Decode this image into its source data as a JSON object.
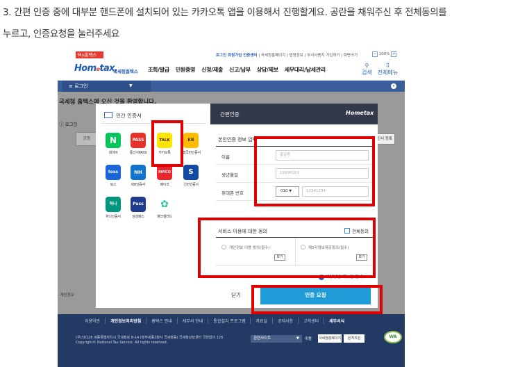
{
  "caption": {
    "line1": "3. 간편 인증 중에 대부분  핸드폰에 설치되어 있는 카카오톡 앱을 이용해서 진행할게요. 공란을 채워주신 후 전체동의를",
    "line2": "누르고, 인증요청을 눌러주세요"
  },
  "hometax": {
    "my_badge": "My홈택스",
    "top_links_bold": "로그인  회원가입  인증센터",
    "top_links": " | 국세청홈페이지 | 법령정보 | 부서사용자 가입하기 | 화면크기",
    "zoom_minus": "−",
    "zoom_value": "100%",
    "zoom_plus": "+",
    "logo_main": "Hom",
    "logo_e": "e",
    "logo_end": "tax,",
    "logo_sub": "국세청홈택스",
    "menu": [
      "조회/발급",
      "민원증명",
      "신청/제출",
      "신고/납부",
      "상담/제보",
      "세무대리/납세관리"
    ],
    "search_icon": "⚲",
    "search_label": "검색",
    "menu_icon": "⠿",
    "menu_label": "전체메뉴",
    "login_tab": "≡ 로그인",
    "login_caret": "▼",
    "expand_icon": "▾",
    "bg_title": "국세청 홈택스에 오신 것을 환영합니다.",
    "bg_line": "ⓘ 로그인",
    "bg_button": "공동",
    "bg_cert": "적용",
    "bg_register": "인서 등록",
    "bg_privacy": "· 개인정보",
    "footer_menu": [
      "이용약관",
      "개인정보처리방침",
      "홈택스 안내",
      "세무서 안내",
      "통합설치 프로그램",
      "자료실",
      "공지사항",
      "고객센터",
      "세무서식"
    ],
    "footer_addr1": "(우)30128 세종특별자치시 국세청로 8-14 (정부세종2청사 국세청동) 국세청상담센터 국번없이 126",
    "footer_addr2": "Copyright© National Tax Service. All rights reserved.",
    "footer_select": "관련사이트",
    "footer_select_caret": "▼",
    "footer_go": "이동",
    "footer_b1": "국세청홈페이지",
    "footer_b2": "원격지원",
    "wa_mark": "WA"
  },
  "cert_panel": {
    "title": "민간 인증서",
    "apps": [
      {
        "glyph": "N",
        "label": "네이버",
        "color": "#03c75a"
      },
      {
        "glyph": "PASS",
        "label": "통신사PASS",
        "color": "#e8312a"
      },
      {
        "glyph": "TALK",
        "label": "카카오톡",
        "color": "#fee500"
      },
      {
        "glyph": "KB",
        "label": "KB국민인증서",
        "color": "#ffbc00"
      },
      {
        "glyph": "toss",
        "label": "토스",
        "color": "#1b64da"
      },
      {
        "glyph": "NH",
        "label": "NH인증서",
        "color": "#1173d0"
      },
      {
        "glyph": "PAYCO",
        "label": "페이코",
        "color": "#e9262b"
      },
      {
        "glyph": "S",
        "label": "신한인증서",
        "color": "#1149a3"
      },
      {
        "glyph": "하나",
        "label": "하나인증서",
        "color": "#00967e"
      },
      {
        "glyph": "Pass",
        "label": "삼성패스",
        "color": "#1f3c8c"
      },
      {
        "glyph": "✿",
        "label": "뱅크샐러드",
        "color": "#2cc19c"
      }
    ]
  },
  "modal": {
    "title": "간편인증",
    "logo": "Hometax",
    "section_title": "본인인증 정보 입력",
    "name_label": "이름",
    "name_placeholder": "홍길동",
    "birth_label": "생년월일",
    "birth_placeholder": "19900101",
    "phone_label": "휴대폰 번호",
    "phone_prefix": "010",
    "phone_caret": "▼",
    "phone_placeholder": "12341234",
    "service_title": "서비스 이용에 대한 동의",
    "agree_all": "전체동의",
    "term1": "개인정보 이용 동의(필수)",
    "term2": "제3자정보제공동의(필수)",
    "view_label": "보기",
    "manual_icon": "?",
    "manual_label": "사용방법 매뉴얼 안내",
    "close_button": "닫기",
    "auth_button": "인증 요청"
  },
  "colors": {
    "highlight": "#e00000",
    "auth_button": "#1f9bd8",
    "footer": "#233a64",
    "nav_bar": "#3a5d9c",
    "modal_header": "#33394a"
  }
}
